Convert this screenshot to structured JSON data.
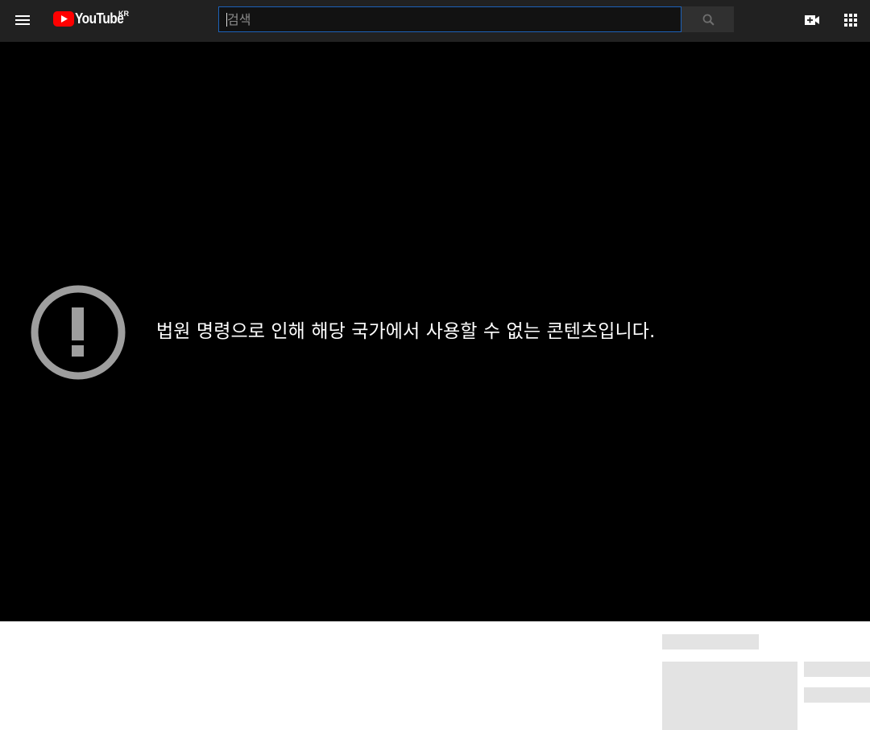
{
  "masthead": {
    "logo_text": "YouTube",
    "country_code": "KR",
    "search_placeholder": "검색",
    "search_value": "",
    "icons": {
      "menu": "hamburger-menu-icon",
      "search": "search-icon",
      "create": "create-video-icon",
      "apps": "apps-grid-icon"
    }
  },
  "player": {
    "error_message": "법원 명령으로 인해 해당 국가에서 사용할 수 없는 콘텐츠입니다.",
    "error_icon": "exclamation-circle-icon"
  },
  "colors": {
    "masthead_bg": "#212121",
    "player_bg": "#000000",
    "brand_red": "#ff0000",
    "search_focus_border": "#1c62b9",
    "error_icon": "#9e9e9e",
    "skeleton": "#e3e3e3"
  }
}
